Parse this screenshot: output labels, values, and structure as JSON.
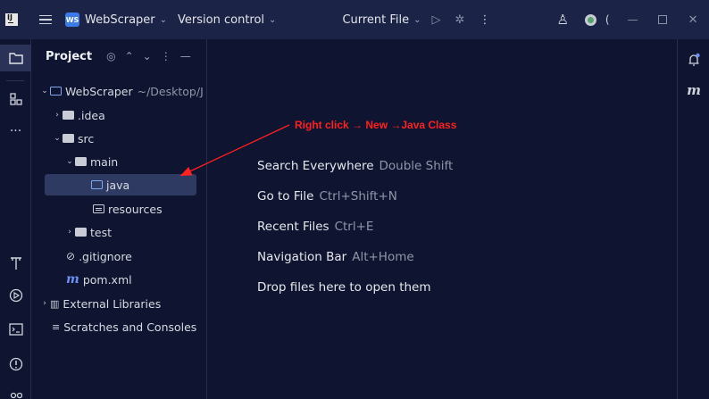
{
  "titlebar": {
    "project_badge": "WS",
    "project_name": "WebScraper",
    "vcs_label": "Version control",
    "run_config": "Current File",
    "more_glyph": "⋮"
  },
  "left_strip": {
    "items": [
      "project-icon",
      "structure-icon",
      "more-tools-icon",
      "terminal-build-icon",
      "run-icon",
      "terminal-icon",
      "problems-icon",
      "git-icon"
    ]
  },
  "panel": {
    "title": "Project",
    "tree": {
      "root_name": "WebScraper",
      "root_path": "~/Desktop/J",
      "idea": ".idea",
      "src": "src",
      "main": "main",
      "java": "java",
      "resources": "resources",
      "test": "test",
      "gitignore": ".gitignore",
      "pom": "pom.xml",
      "external_libs": "External Libraries",
      "scratches": "Scratches and Consoles"
    }
  },
  "editor": {
    "annotation": "Right click →  New →Java Class",
    "hints": [
      {
        "label": "Search Everywhere",
        "key": "Double Shift"
      },
      {
        "label": "Go to File",
        "key": "Ctrl+Shift+N"
      },
      {
        "label": "Recent Files",
        "key": "Ctrl+E"
      },
      {
        "label": "Navigation Bar",
        "key": "Alt+Home"
      },
      {
        "label": "Drop files here to open them",
        "key": ""
      }
    ]
  },
  "right_strip": {
    "m_label": "m"
  },
  "colors": {
    "background": "#0f1530",
    "titlebar": "#1b2346",
    "selection": "#2f3a63",
    "annotation": "#ff2020",
    "accent": "#3b7ae8"
  }
}
